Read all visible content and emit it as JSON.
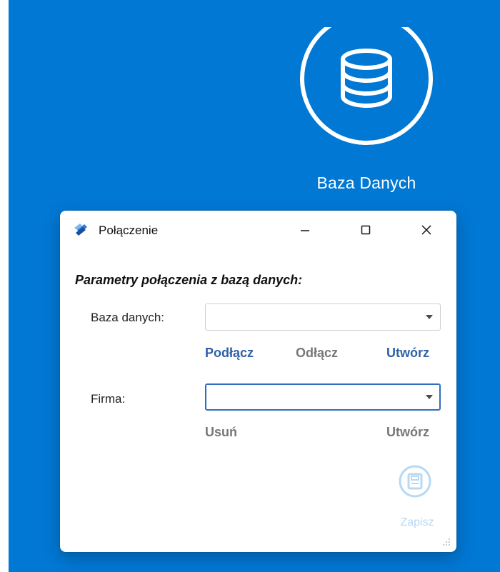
{
  "background": {
    "color": "#0078d4"
  },
  "tile": {
    "icon": "database-icon",
    "label": "Baza Danych"
  },
  "dialog": {
    "title": "Połączenie",
    "app_icon": "app-logo-icon",
    "controls": {
      "minimize_icon": "minimize-icon",
      "maximize_icon": "maximize-icon",
      "close_icon": "close-icon"
    },
    "section_title": "Parametry połączenia z bazą danych:",
    "database": {
      "label": "Baza danych:",
      "value": "",
      "actions": {
        "connect": "Podłącz",
        "disconnect": "Odłącz",
        "create": "Utwórz"
      }
    },
    "company": {
      "label": "Firma:",
      "value": "",
      "actions": {
        "remove": "Usuń",
        "create": "Utwórz"
      }
    },
    "save": {
      "icon": "save-icon",
      "label": "Zapisz"
    },
    "resize_icon": "resize-grip-icon"
  },
  "colors": {
    "accent": "#2f61a8",
    "muted": "#777777",
    "focus": "#2f6ebc",
    "disabled": "#b7d9f4"
  }
}
